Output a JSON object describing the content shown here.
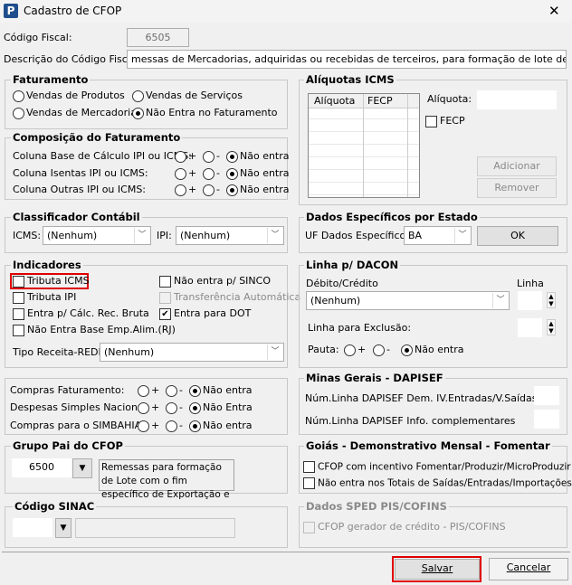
{
  "window": {
    "title": "Cadastro de CFOP",
    "close": "✕",
    "logo": "P"
  },
  "codigo_fiscal": {
    "label": "Código Fiscal:",
    "value": "6505"
  },
  "descricao": {
    "label": "Descrição do Código Fiscal:",
    "value": "messas de Mercadorias, adquiridas ou recebidas de terceiros, para formação de lote de Exportação."
  },
  "faturamento": {
    "title": "Faturamento",
    "options": [
      "Vendas de Produtos",
      "Vendas de Serviços",
      "Vendas de Mercadorias",
      "Não Entra no Faturamento"
    ],
    "selected": "Não Entra no Faturamento"
  },
  "composicao": {
    "title": "Composição do Faturamento",
    "rows": [
      {
        "label": "Coluna Base de Cálculo IPI ou ICMS:",
        "selected": "Não entra"
      },
      {
        "label": "Coluna Isentas IPI ou ICMS:",
        "selected": "Não entra"
      },
      {
        "label": "Coluna Outras IPI ou ICMS:",
        "selected": "Não entra"
      }
    ],
    "plus": "+",
    "minus": "-",
    "none": "Não entra"
  },
  "classificador": {
    "title": "Classificador Contábil",
    "icms_label": "ICMS:",
    "icms_value": "(Nenhum)",
    "ipi_label": "IPI:",
    "ipi_value": "(Nenhum)"
  },
  "indicadores": {
    "title": "Indicadores",
    "tributa_icms": "Tributa ICMS",
    "tributa_ipi": "Tributa IPI",
    "entra_calc": "Entra p/ Cálc. Rec. Bruta",
    "nao_entra_base": "Não Entra Base Emp.Alim.(RJ)",
    "nao_sinco": "Não entra p/ SINCO",
    "transferencia": "Transferência Automática",
    "entra_dot": "Entra para DOT",
    "entra_dot_checked": true,
    "tipo_receita_label": "Tipo Receita-REDF:",
    "tipo_receita_value": "(Nenhum)"
  },
  "compras": {
    "rows": [
      {
        "label": "Compras Faturamento:",
        "none": "Não entra"
      },
      {
        "label": "Despesas Simples Nacional:",
        "none": "Não Entra"
      },
      {
        "label": "Compras para o SIMBAHIA:",
        "none": "Não entra"
      }
    ],
    "plus": "+",
    "minus": "-"
  },
  "grupo_pai": {
    "title": "Grupo Pai do CFOP",
    "value": "6500",
    "description": "Remessas para formação de Lote com o fim específico de Exportação e"
  },
  "sinac": {
    "title": "Código SINAC",
    "value": ""
  },
  "aliquotas": {
    "title": "Alíquotas ICMS",
    "columns": [
      "Alíquota",
      "FECP"
    ],
    "aliquota_label": "Alíquota:",
    "fecp_label": "FECP",
    "add": "Adicionar",
    "remove": "Remover"
  },
  "dados_estado": {
    "title": "Dados Específicos por Estado",
    "uf_label": "UF Dados Específicos:",
    "uf_value": "BA",
    "ok": "OK"
  },
  "dacon": {
    "title": "Linha p/ DACON",
    "debito_label": "Débito/Crédito",
    "debito_value": "(Nenhum)",
    "linha_label": "Linha",
    "exclusao_label": "Linha para Exclusão:",
    "pauta_label": "Pauta:",
    "plus": "+",
    "minus": "-",
    "none": "Não entra"
  },
  "minas": {
    "title": "Minas Gerais - DAPISEF",
    "row1": "Núm.Linha DAPISEF Dem. IV.Entradas/V.Saídas",
    "row2": "Núm.Linha DAPISEF Info. complementares"
  },
  "goias": {
    "title": "Goiás - Demonstrativo Mensal - Fomentar",
    "opt1": "CFOP com incentivo  Fomentar/Produzir/MicroProduzir",
    "opt2": "Não entra nos Totais de  Saídas/Entradas/Importações"
  },
  "sped": {
    "title": "Dados SPED PIS/COFINS",
    "opt1": "CFOP gerador de crédito - PIS/COFINS"
  },
  "buttons": {
    "save": "Salvar",
    "cancel": "Cancelar"
  }
}
